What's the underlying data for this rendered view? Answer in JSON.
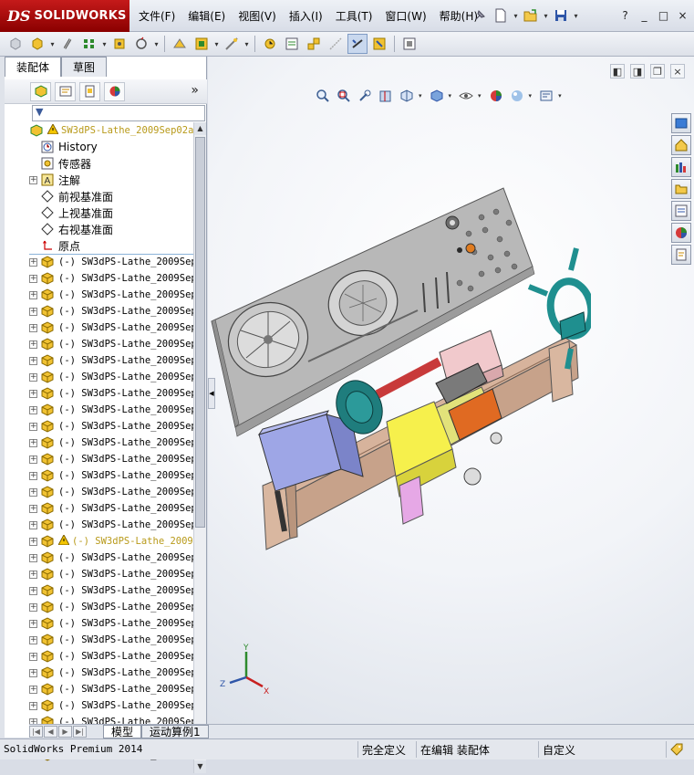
{
  "app": {
    "logo_mark": "DS",
    "logo_text": "SOLIDWORKS"
  },
  "menu": {
    "items": [
      "文件(F)",
      "编辑(E)",
      "视图(V)",
      "插入(I)",
      "工具(T)",
      "窗口(W)",
      "帮助(H)"
    ]
  },
  "window_controls": {
    "help": "?",
    "minimize": "_",
    "restore": "□",
    "close": "×"
  },
  "feature_manager": {
    "tabs": [
      "装配体",
      "草图"
    ],
    "expand_glyph": "»",
    "filter_glyph": "▼",
    "root": "SW3dPS-Lathe_2009Sep02a",
    "fixed_items": [
      {
        "label": "History",
        "icon": "history-icon"
      },
      {
        "label": "传感器",
        "icon": "sensor-icon"
      },
      {
        "label": "注解",
        "icon": "annotation-icon",
        "expandable": true
      },
      {
        "label": "前视基准面",
        "icon": "plane-icon"
      },
      {
        "label": "上视基准面",
        "icon": "plane-icon"
      },
      {
        "label": "右视基准面",
        "icon": "plane-icon"
      },
      {
        "label": "原点",
        "icon": "origin-icon"
      }
    ],
    "components": [
      "(-) SW3dPS-Lathe_2009Sep",
      "(-) SW3dPS-Lathe_2009Sep",
      "(-) SW3dPS-Lathe_2009Sep",
      "(-) SW3dPS-Lathe_2009Sep",
      "(-) SW3dPS-Lathe_2009Sep",
      "(-) SW3dPS-Lathe_2009Sep",
      "(-) SW3dPS-Lathe_2009Sep",
      "(-) SW3dPS-Lathe_2009Sep",
      "(-) SW3dPS-Lathe_2009Sep",
      "(-) SW3dPS-Lathe_2009Sep",
      "(-) SW3dPS-Lathe_2009Sep",
      "(-) SW3dPS-Lathe_2009Sep",
      "(-) SW3dPS-Lathe_2009Sep",
      "(-) SW3dPS-Lathe_2009Sep",
      "(-) SW3dPS-Lathe_2009Sep",
      "(-) SW3dPS-Lathe_2009Sep",
      "(-) SW3dPS-Lathe_2009Sep",
      "(-) SW3dPS-Lathe_2009",
      "(-) SW3dPS-Lathe_2009Sep",
      "(-) SW3dPS-Lathe_2009Sep",
      "(-) SW3dPS-Lathe_2009Sep",
      "(-) SW3dPS-Lathe_2009Sep",
      "(-) SW3dPS-Lathe_2009Sep",
      "(-) SW3dPS-Lathe_2009Sep",
      "(-) SW3dPS-Lathe_2009Sep",
      "(-) SW3dPS-Lathe_2009Sep",
      "(-) SW3dPS-Lathe_2009Sep",
      "(-) SW3dPS-Lathe_2009Sep",
      "(-) SW3dPS-Lathe_2009Sep",
      "(-) SW3dPS-Lathe_2009Sep",
      "(-) SW3dPS-Lathe_2009Sep"
    ],
    "warning_component_index": 17
  },
  "bottom_tabs": [
    "模型",
    "运动算例1"
  ],
  "status": {
    "product": "SolidWorks Premium 2014",
    "definition": "完全定义",
    "editing": "在编辑 装配体",
    "units": "自定义"
  },
  "triad": {
    "x": "X",
    "y": "Y",
    "z": "Z"
  },
  "colors": {
    "brand_red": "#b30f0f",
    "viewport_bg": "#f2f4f8",
    "part_yellow": "#c9a400"
  }
}
